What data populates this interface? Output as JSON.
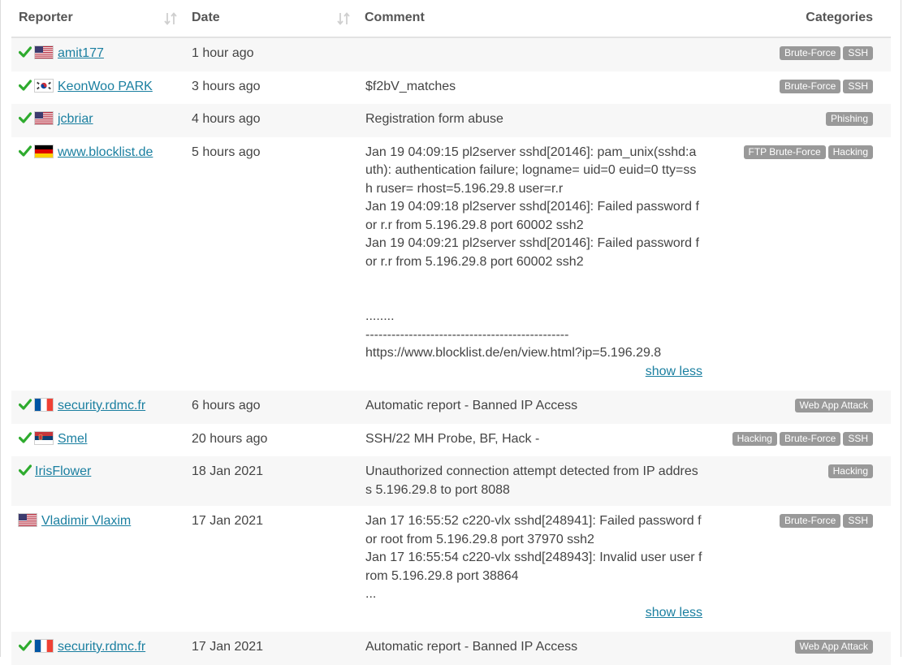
{
  "columns": {
    "reporter": "Reporter",
    "date": "Date",
    "comment": "Comment",
    "categories": "Categories"
  },
  "colors": {
    "accent": "#1a7fa0",
    "check": "#2eab2e",
    "badge": "#999999"
  },
  "reports": [
    {
      "verified": true,
      "flag": "us",
      "reporter": "amit177",
      "date": "1 hour ago",
      "comment": "",
      "show_link": "",
      "categories": [
        "Brute-Force",
        "SSH"
      ]
    },
    {
      "verified": true,
      "flag": "kr",
      "reporter": "KeonWoo PARK",
      "date": "3 hours ago",
      "comment": "$f2bV_matches",
      "show_link": "",
      "categories": [
        "Brute-Force",
        "SSH"
      ]
    },
    {
      "verified": true,
      "flag": "us",
      "reporter": "jcbriar",
      "date": "4 hours ago",
      "comment": "Registration form abuse",
      "show_link": "",
      "categories": [
        "Phishing"
      ]
    },
    {
      "verified": true,
      "flag": "de",
      "reporter": "www.blocklist.de",
      "date": "5 hours ago",
      "comment": "Jan 19 04:09:15 pl2server sshd[20146]: pam_unix(sshd:auth): authentication failure; logname= uid=0 euid=0 tty=ssh ruser= rhost=5.196.29.8 user=r.r\nJan 19 04:09:18 pl2server sshd[20146]: Failed password for r.r from 5.196.29.8 port 60002 ssh2\nJan 19 04:09:21 pl2server sshd[20146]: Failed password for r.r from 5.196.29.8 port 60002 ssh2\n\n\n........\n-----------------------------------------------\nhttps://www.blocklist.de/en/view.html?ip=5.196.29.8",
      "show_link": "show less",
      "categories": [
        "FTP Brute-Force",
        "Hacking"
      ]
    },
    {
      "verified": true,
      "flag": "fr",
      "reporter": "security.rdmc.fr",
      "date": "6 hours ago",
      "comment": "Automatic report - Banned IP Access",
      "show_link": "",
      "categories": [
        "Web App Attack"
      ]
    },
    {
      "verified": true,
      "flag": "rs",
      "reporter": "Smel",
      "date": "20 hours ago",
      "comment": "SSH/22 MH Probe, BF, Hack -",
      "show_link": "",
      "categories": [
        "Hacking",
        "Brute-Force",
        "SSH"
      ]
    },
    {
      "verified": true,
      "flag": "",
      "reporter": "IrisFlower",
      "date": "18 Jan 2021",
      "comment": "Unauthorized connection attempt detected from IP address 5.196.29.8 to port 8088",
      "show_link": "",
      "categories": [
        "Hacking"
      ]
    },
    {
      "verified": false,
      "flag": "us",
      "reporter": "Vladimir Vlaxim",
      "date": "17 Jan 2021",
      "comment": "Jan 17 16:55:52 c220-vlx sshd[248941]: Failed password for root from 5.196.29.8 port 37970 ssh2\nJan 17 16:55:54 c220-vlx sshd[248943]: Invalid user user from 5.196.29.8 port 38864\n...",
      "show_link": "show less",
      "categories": [
        "Brute-Force",
        "SSH"
      ]
    },
    {
      "verified": true,
      "flag": "fr",
      "reporter": "security.rdmc.fr",
      "date": "17 Jan 2021",
      "comment": "Automatic report - Banned IP Access",
      "show_link": "",
      "categories": [
        "Web App Attack"
      ]
    }
  ]
}
